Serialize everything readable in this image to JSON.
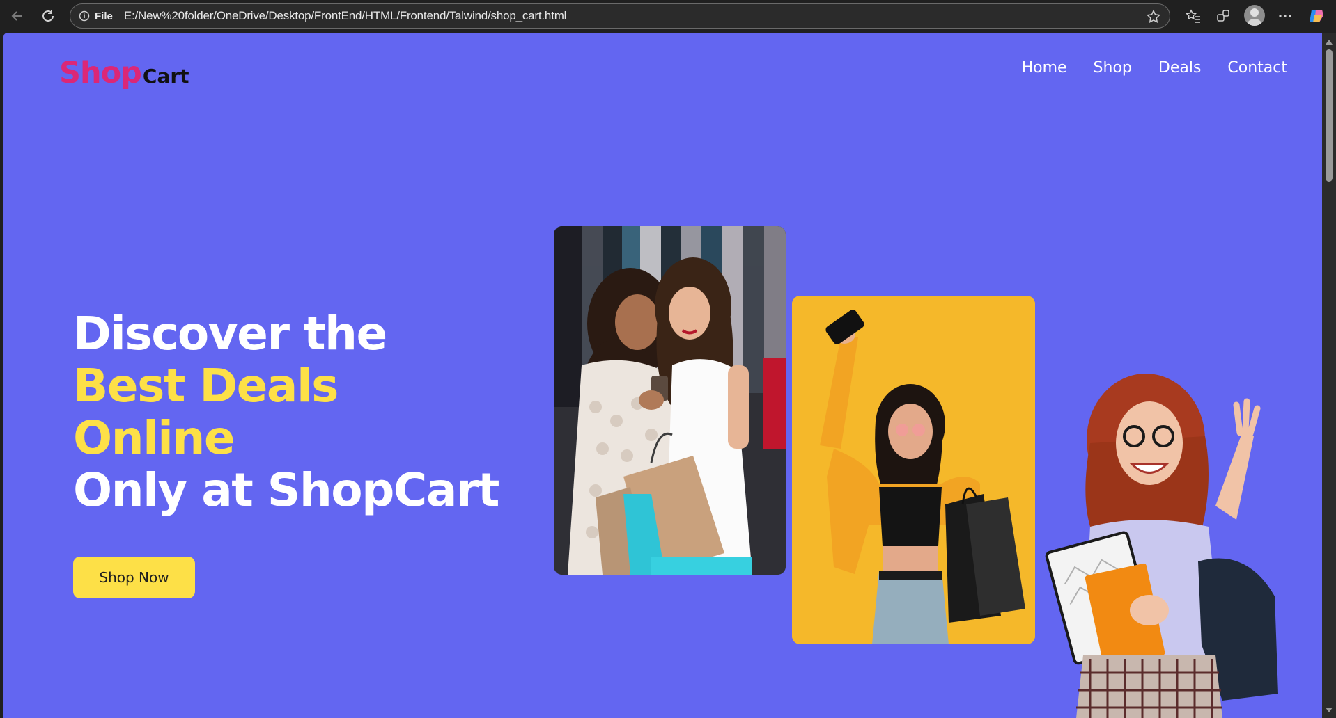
{
  "browser": {
    "file_label": "File",
    "url": "E:/New%20folder/OneDrive/Desktop/FrontEnd/HTML/Frontend/Talwind/shop_cart.html",
    "icons": [
      "back-icon",
      "reload-icon",
      "info-icon",
      "star-icon",
      "favorites-icon",
      "extensions-icon",
      "profile-avatar",
      "more-icon",
      "copilot-icon"
    ]
  },
  "logo": {
    "part1": "Shop",
    "part2": "Cart"
  },
  "nav": {
    "items": [
      "Home",
      "Shop",
      "Deals",
      "Contact"
    ]
  },
  "hero": {
    "line1": "Discover the",
    "line2": "Best Deals",
    "line3": "Online",
    "line4": "Only at ShopCart"
  },
  "cta": {
    "label": "Shop Now"
  },
  "colors": {
    "page_bg": "#6366f1",
    "logo_pink": "#db2777",
    "accent_yellow": "#fde047",
    "card2_bg": "#f5b82a"
  }
}
